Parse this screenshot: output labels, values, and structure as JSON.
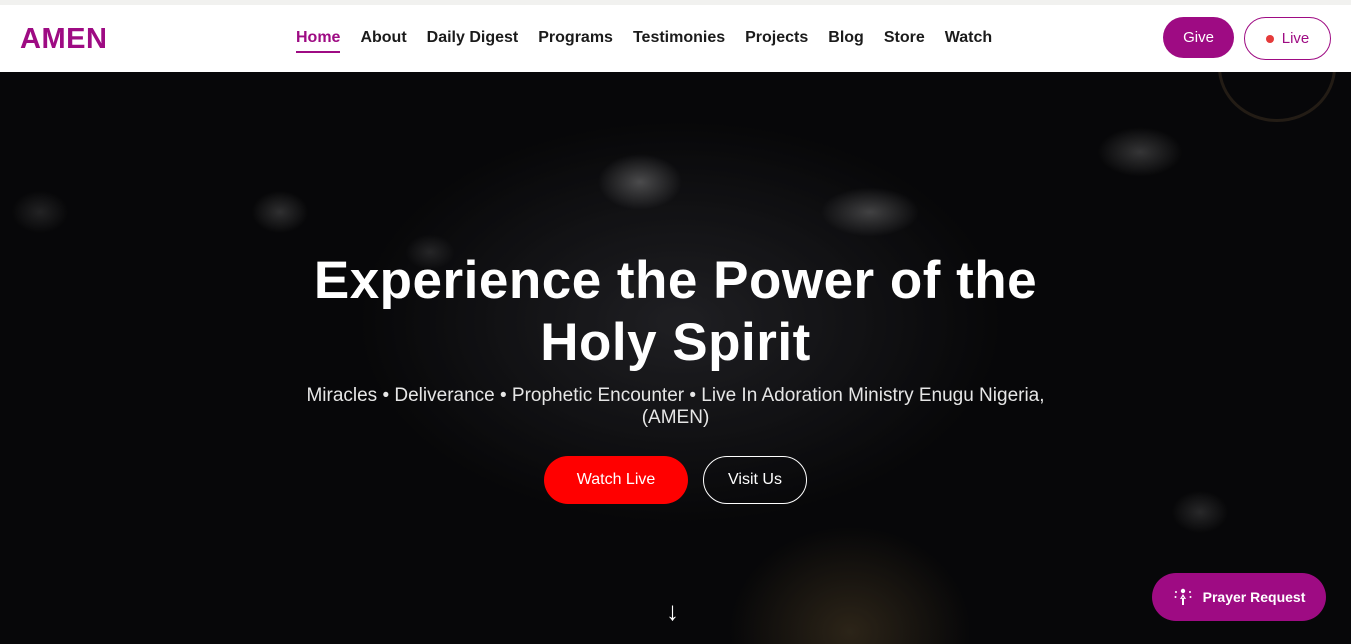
{
  "header": {
    "logo": "AMEN",
    "nav": [
      {
        "label": "Home",
        "active": true
      },
      {
        "label": "About"
      },
      {
        "label": "Daily Digest"
      },
      {
        "label": "Programs"
      },
      {
        "label": "Testimonies"
      },
      {
        "label": "Projects"
      },
      {
        "label": "Blog"
      },
      {
        "label": "Store"
      },
      {
        "label": "Watch"
      }
    ],
    "give_label": "Give",
    "live_label": "Live"
  },
  "hero": {
    "title": "Experience the Power of the Holy Spirit",
    "subtitle": "Miracles • Deliverance • Prophetic Encounter • Live In Adoration Ministry Enugu Nigeria, (AMEN)",
    "watch_live_label": "Watch Live",
    "visit_us_label": "Visit Us",
    "scroll_arrow": "↓"
  },
  "floating": {
    "prayer_request_label": "Prayer Request"
  },
  "colors": {
    "brand": "#9e0b83",
    "live_red": "#ff0000",
    "live_dot": "#e53a3a"
  },
  "icons": [
    "live-dot-icon",
    "down-arrow-icon",
    "praying-hands-icon"
  ]
}
